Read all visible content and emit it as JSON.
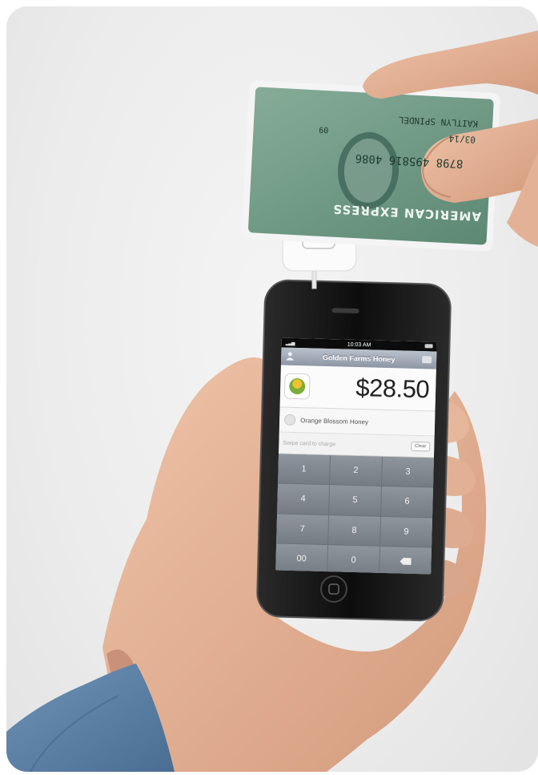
{
  "card": {
    "brand": "AMERICAN EXPRESS",
    "holder": "KAITLYN SPINDEL",
    "number": "8798 495816 4086",
    "expiry": "03/14",
    "member_since": "09"
  },
  "app": {
    "time": "10:03 AM",
    "merchant": "Golden Farms Honey",
    "amount": "$28.50",
    "item": "Orange Blossom Honey",
    "swipe_prompt": "Swipe card to charge",
    "clear_label": "Clear"
  },
  "keypad": {
    "keys": [
      "1",
      "2",
      "3",
      "4",
      "5",
      "6",
      "7",
      "8",
      "9",
      "00",
      "0",
      "⌫"
    ]
  },
  "colors": {
    "card_green": "#6f9b86",
    "phone_black": "#151515",
    "skin": "#e6b49a",
    "sleeve_denim": "#5b7fa4"
  }
}
